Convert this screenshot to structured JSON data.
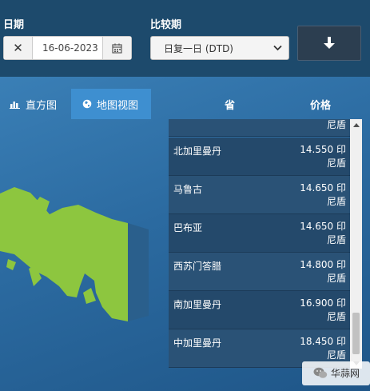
{
  "filters": {
    "date_label": "日期",
    "date_value": "16-06-2023",
    "compare_label": "比较期",
    "compare_value": "日复一日 (DTD)"
  },
  "tabs": [
    {
      "label": "直方图",
      "icon": "bar-chart-icon"
    },
    {
      "label": "地图视图",
      "icon": "globe-icon"
    }
  ],
  "table": {
    "col_province": "省",
    "col_price": "价格",
    "partial_top": "尼盾",
    "rows": [
      {
        "province": "北加里曼丹",
        "price_line1": "14.550 印",
        "price_line2": "尼盾"
      },
      {
        "province": "马鲁古",
        "price_line1": "14.650 印",
        "price_line2": "尼盾"
      },
      {
        "province": "巴布亚",
        "price_line1": "14.650 印",
        "price_line2": "尼盾"
      },
      {
        "province": "西苏门答腊",
        "price_line1": "14.800 印",
        "price_line2": "尼盾"
      },
      {
        "province": "南加里曼丹",
        "price_line1": "16.900 印",
        "price_line2": "尼盾"
      },
      {
        "province": "中加里曼丹",
        "price_line1": "18.450 印",
        "price_line2": "尼盾"
      }
    ]
  },
  "watermark": "华蒜网",
  "colors": {
    "map_land": "#8dc63f",
    "active_tab": "#3e8fd0",
    "header_bg": "#1d4a6c"
  }
}
